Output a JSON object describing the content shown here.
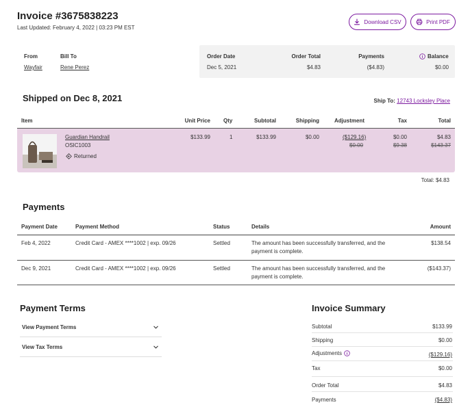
{
  "header": {
    "title": "Invoice #3675838223",
    "last_updated": "Last Updated: February 4, 2022 | 03:23 PM EST",
    "download_csv": "Download CSV",
    "print_pdf": "Print PDF"
  },
  "summary": {
    "from_label": "From",
    "from_value": "Wayfair",
    "billto_label": "Bill To",
    "billto_value": "Rene Perez",
    "order_date_label": "Order Date",
    "order_date_value": "Dec 5, 2021",
    "order_total_label": "Order Total",
    "order_total_value": "$4.83",
    "payments_label": "Payments",
    "payments_value": "($4.83)",
    "balance_label": "Balance",
    "balance_value": "$0.00"
  },
  "shipment": {
    "title": "Shipped on Dec 8, 2021",
    "ship_to_label": "Ship To:",
    "ship_to_value": "12743 Locksley Place",
    "columns": {
      "item": "Item",
      "unit_price": "Unit Price",
      "qty": "Qty",
      "subtotal": "Subtotal",
      "shipping": "Shipping",
      "adjustment": "Adjustment",
      "tax": "Tax",
      "total": "Total"
    },
    "item": {
      "name": "Guardian Handrail",
      "sku": "OSIC1003",
      "status": "Returned",
      "unit_price": "$133.99",
      "qty": "1",
      "subtotal": "$133.99",
      "shipping": "$0.00",
      "adjustment": "($129.16)",
      "adjustment_old": "$0.00",
      "tax": "$0.00",
      "tax_old": "$9.38",
      "total": "$4.83",
      "total_old": "$143.37"
    },
    "total_line": "Total: $4.83"
  },
  "payments": {
    "title": "Payments",
    "columns": {
      "date": "Payment Date",
      "method": "Payment Method",
      "status": "Status",
      "details": "Details",
      "amount": "Amount"
    },
    "rows": [
      {
        "date": "Feb 4, 2022",
        "method": "Credit Card - AMEX ****1002 | exp. 09/26",
        "status": "Settled",
        "details_1": "The amount has been successfully transferred, and the",
        "details_2": "payment is complete.",
        "amount": "$138.54"
      },
      {
        "date": "Dec 9, 2021",
        "method": "Credit Card - AMEX ****1002 | exp. 09/26",
        "status": "Settled",
        "details_1": "The amount has been successfully transferred, and the",
        "details_2": "payment is complete.",
        "amount": "($143.37)"
      }
    ]
  },
  "terms": {
    "title": "Payment Terms",
    "view_payment_terms": "View Payment Terms",
    "view_tax_terms": "View Tax Terms"
  },
  "invoice_summary": {
    "title": "Invoice Summary",
    "subtotal_label": "Subtotal",
    "subtotal_value": "$133.99",
    "shipping_label": "Shipping",
    "shipping_value": "$0.00",
    "adjustments_label": "Adjustments",
    "adjustments_value": "($129.16)",
    "tax_label": "Tax",
    "tax_value": "$0.00",
    "order_total_label": "Order Total",
    "order_total_value": "$4.83",
    "payments_label": "Payments",
    "payments_value": "($4.83)"
  },
  "colors": {
    "accent": "#7b189f",
    "item_row_bg": "#e8d2e4",
    "strip_bg": "#f2f2f2"
  }
}
